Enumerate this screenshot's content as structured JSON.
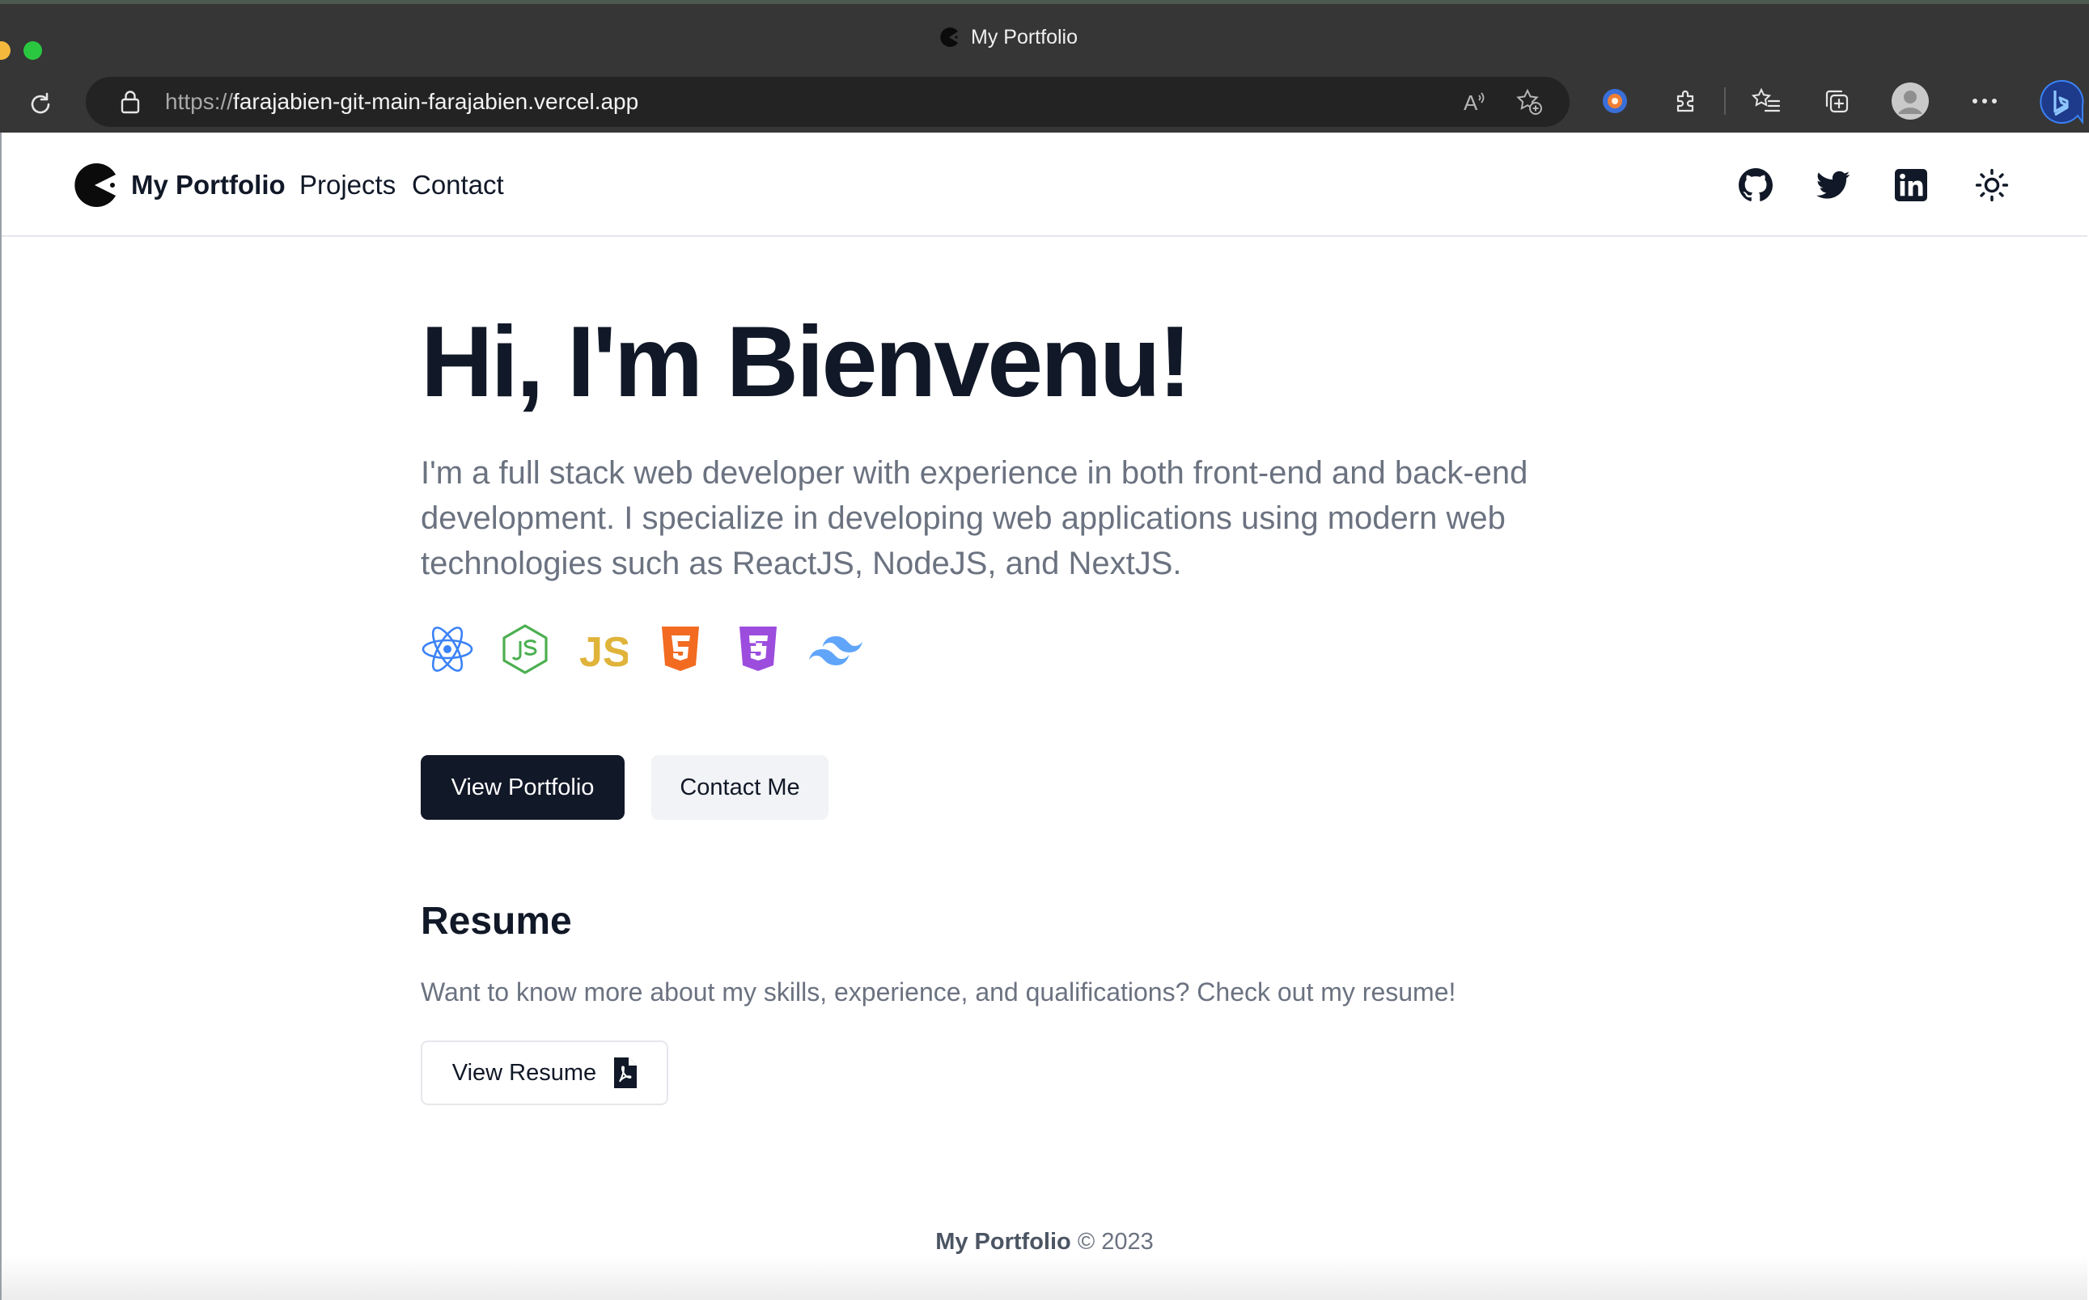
{
  "browser": {
    "tab_title": "My Portfolio",
    "url_scheme": "https://",
    "url_host": "farajabien-git-main-farajabien.vercel.app",
    "toolbar_icons": [
      "read-aloud-icon",
      "add-favorite-icon",
      "extension-app-icon",
      "extensions-icon",
      "favorites-icon",
      "collections-icon",
      "profile-icon",
      "more-icon",
      "bing-icon"
    ]
  },
  "navbar": {
    "brand": "My Portfolio",
    "links": [
      "Projects",
      "Contact"
    ],
    "social_icons": [
      "github-icon",
      "twitter-icon",
      "linkedin-icon",
      "theme-toggle-sun-icon"
    ]
  },
  "hero": {
    "title": "Hi, I'm Bienvenu!",
    "description": "I'm a full stack web developer with experience in both front-end and back-end development. I specialize in developing web applications using modern web technologies such as ReactJS, NodeJS, and NextJS.",
    "tech_icons": [
      "react-icon",
      "nodejs-icon",
      "javascript-icon",
      "html5-icon",
      "css3-icon",
      "tailwind-icon"
    ],
    "primary_button": "View Portfolio",
    "secondary_button": "Contact Me"
  },
  "resume": {
    "title": "Resume",
    "description": "Want to know more about my skills, experience, and qualifications? Check out my resume!",
    "button": "View Resume"
  },
  "footer": {
    "brand": "My Portfolio",
    "copyright": "© 2023"
  },
  "colors": {
    "chrome_bg": "#363636",
    "text_dark": "#111827",
    "text_muted": "#6b7280",
    "primary_button": "#111827",
    "secondary_button": "#f1f3f6"
  }
}
